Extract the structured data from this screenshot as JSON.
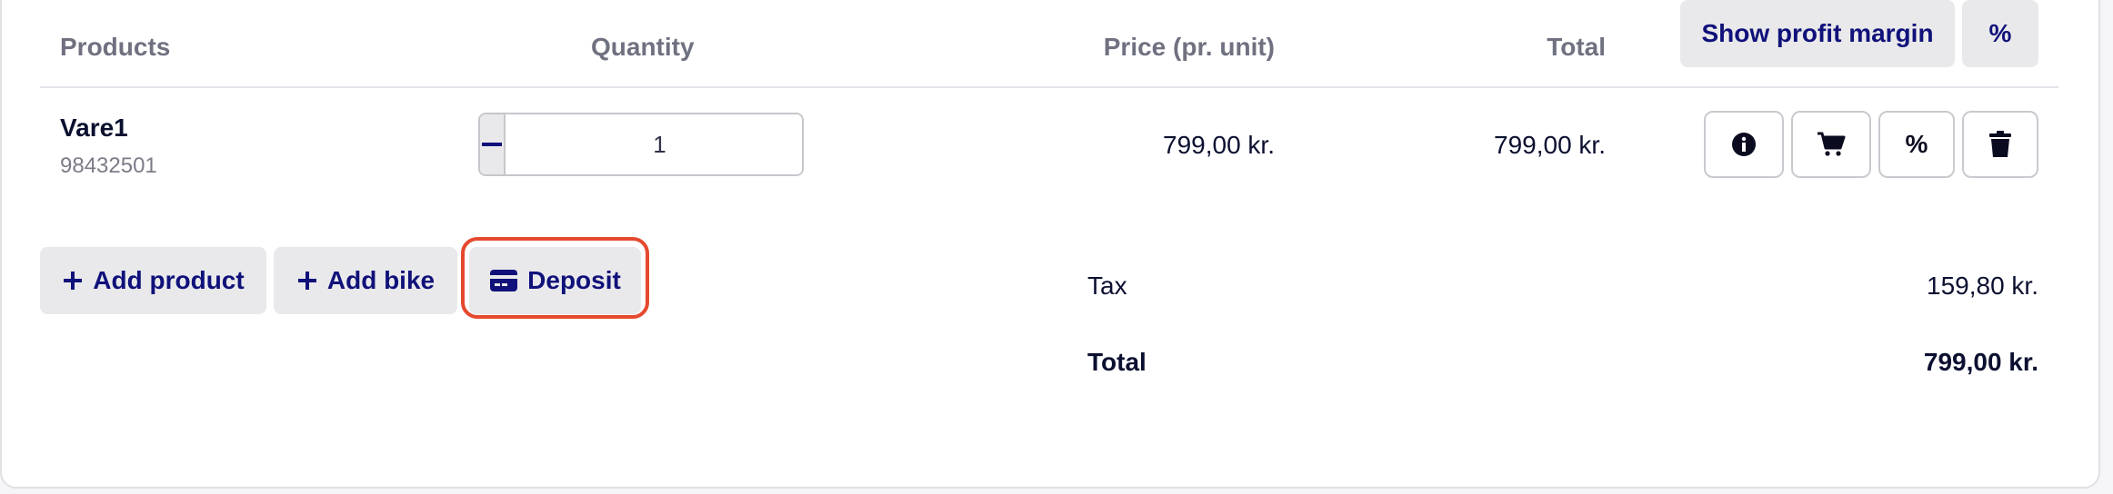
{
  "table": {
    "headers": {
      "products": "Products",
      "quantity": "Quantity",
      "price": "Price (pr. unit)",
      "total": "Total"
    },
    "toolbar": {
      "profit_margin_label": "Show profit margin",
      "percent_label": "%"
    },
    "rows": [
      {
        "name": "Vare1",
        "sku": "98432501",
        "quantity": "1",
        "price": "799,00 kr.",
        "total": "799,00 kr.",
        "actions": {
          "info_icon": "info-circle-icon",
          "cart_icon": "cart-icon",
          "percent_label": "%",
          "delete_icon": "trash-icon"
        }
      }
    ]
  },
  "actions": {
    "add_product_label": "Add product",
    "add_bike_label": "Add bike",
    "deposit_label": "Deposit"
  },
  "summary": {
    "tax_label": "Tax",
    "tax_value": "159,80 kr.",
    "total_label": "Total",
    "total_value": "799,00 kr."
  },
  "colors": {
    "accent": "#10117a",
    "button_bg": "#e9e9eb",
    "highlight_outline": "#e5492f"
  }
}
